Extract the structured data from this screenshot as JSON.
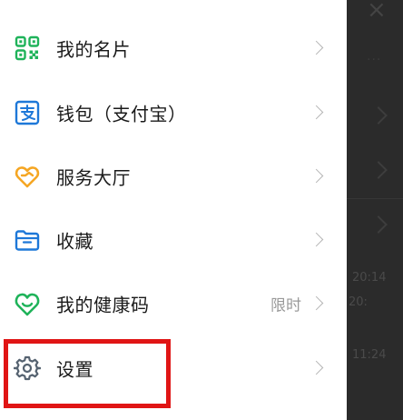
{
  "menu": {
    "items": [
      {
        "id": "business-card",
        "label": "我的名片",
        "icon": "qr-code-icon",
        "note": ""
      },
      {
        "id": "wallet",
        "label": "钱包（支付宝）",
        "icon": "alipay-icon",
        "note": ""
      },
      {
        "id": "service-hall",
        "label": "服务大厅",
        "icon": "heart-hands-icon",
        "note": ""
      },
      {
        "id": "favorites",
        "label": "收藏",
        "icon": "folder-icon",
        "note": ""
      },
      {
        "id": "health-code",
        "label": "我的健康码",
        "icon": "health-code-icon",
        "note": "限时"
      },
      {
        "id": "settings",
        "label": "设置",
        "icon": "gear-icon",
        "note": ""
      }
    ]
  },
  "background": {
    "times": [
      "20:14",
      "20:",
      "11:24"
    ]
  },
  "colors": {
    "green": "#1fb35a",
    "blue": "#1e78d8",
    "orange": "#f5a623",
    "gray_icon": "#556270",
    "highlight": "#e01515"
  }
}
